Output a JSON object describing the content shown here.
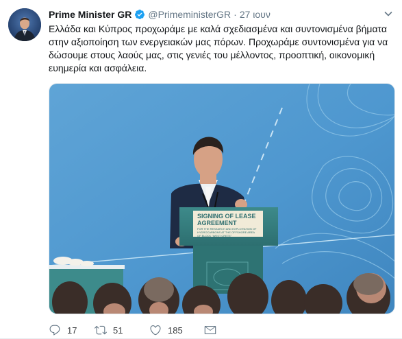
{
  "tweet": {
    "author_name": "Prime Minister GR",
    "handle": "@PrimeministerGR",
    "separator": "·",
    "time": "27 ιουν",
    "text": "Ελλάδα και Κύπρος προχωράμε με καλά σχεδιασμένα και συντονισμένα βήματα στην αξιοποίηση των ενεργειακών μας πόρων. Προχωράμε συντονισμένα για να δώσουμε στους λαούς μας, στις γενιές του μέλλοντος, προοπτική, οικονομική ευημερία και ασφάλεια.",
    "media": {
      "podium_sign_line1": "SIGNING OF LEASE",
      "podium_sign_line2": "AGREEMENT",
      "podium_sign_small": "FOR THE RESEARCH AND EXPLOITATION OF HYDROCARBONS AT THE OFFSHORE AREA OF BLOCK \"WEST CRETE\""
    },
    "actions": {
      "reply_count": "17",
      "retweet_count": "51",
      "like_count": "185"
    }
  },
  "icons": {
    "verified": "verified-badge-icon",
    "caret": "chevron-down-icon",
    "reply": "reply-icon",
    "retweet": "retweet-icon",
    "like": "heart-icon",
    "dm": "envelope-icon"
  },
  "colors": {
    "verified": "#1da1f2",
    "secondary_text": "#657786",
    "primary_text": "#14171a"
  }
}
